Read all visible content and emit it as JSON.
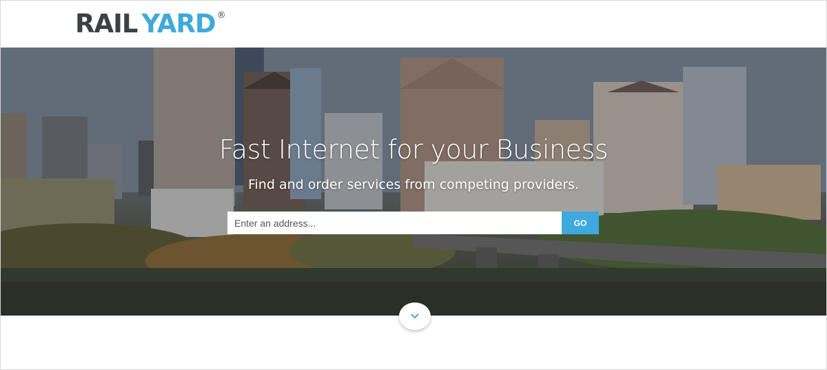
{
  "header": {
    "logo": {
      "part1": "RAIL",
      "part2": "YARD",
      "registered": "®"
    }
  },
  "hero": {
    "title": "Fast Internet for your Business",
    "subtitle": "Find and order services from competing providers.",
    "search": {
      "placeholder": "Enter an address...",
      "value": "",
      "button_label": "GO"
    },
    "scroll_icon": "chevron-down-icon"
  },
  "colors": {
    "brand_dark": "#3d4145",
    "brand_blue": "#3ea9dc",
    "button_blue": "#3fa9dd",
    "text_on_hero": "#ffffff"
  }
}
